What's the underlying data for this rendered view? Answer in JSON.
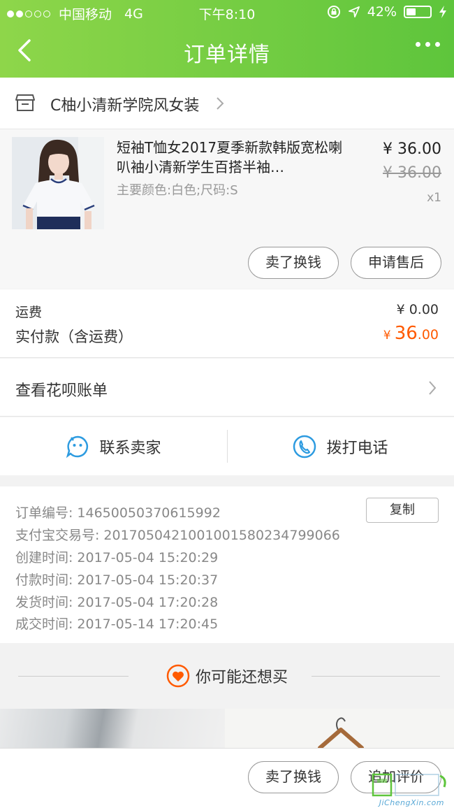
{
  "status_bar": {
    "carrier": "中国移动",
    "network": "4G",
    "time": "下午8:10",
    "battery_percent": "42%",
    "battery_level": 0.42
  },
  "nav": {
    "title": "订单详情",
    "back_icon": "chevron-left-icon",
    "more_icon": "more-dots-icon"
  },
  "shop": {
    "name": "C柚小清新学院风女装",
    "icon": "store-icon"
  },
  "product": {
    "title": "短袖T恤女2017夏季新款韩版宽松喇叭袖小清新学生百搭半袖…",
    "spec": "主要颜色:白色;尺码:S",
    "price": "¥ 36.00",
    "original_price": "¥ 36.00",
    "quantity": "x1",
    "buttons": {
      "sell": "卖了换钱",
      "after_sale": "申请售后"
    }
  },
  "fees": {
    "shipping_label": "运费",
    "shipping_value": "¥ 0.00",
    "paid_label": "实付款（含运费）",
    "paid_currency": "¥",
    "paid_int": "36",
    "paid_dec": ".00"
  },
  "huabei": {
    "label": "查看花呗账单"
  },
  "contact": {
    "seller": "联系卖家",
    "phone": "拨打电话"
  },
  "order_info": {
    "copy_label": "复制",
    "lines": [
      {
        "key": "订单编号:",
        "value": "14650050370615992"
      },
      {
        "key": "支付宝交易号:",
        "value": "2017050421001001580234799066"
      },
      {
        "key": "创建时间:",
        "value": "2017-05-04 15:20:29"
      },
      {
        "key": "付款时间:",
        "value": "2017-05-04 15:20:37"
      },
      {
        "key": "发货时间:",
        "value": "2017-05-04 17:20:28"
      },
      {
        "key": "成交时间:",
        "value": "2017-05-14 17:20:45"
      }
    ]
  },
  "recommend": {
    "title": "你可能还想买"
  },
  "bottom_bar": {
    "sell": "卖了换钱",
    "review": "追加评价"
  },
  "watermark": {
    "site": "JiChengXin.com"
  },
  "colors": {
    "header_green": "#6cc93e",
    "price_orange": "#ff5a00",
    "icon_blue": "#2d9be0"
  }
}
